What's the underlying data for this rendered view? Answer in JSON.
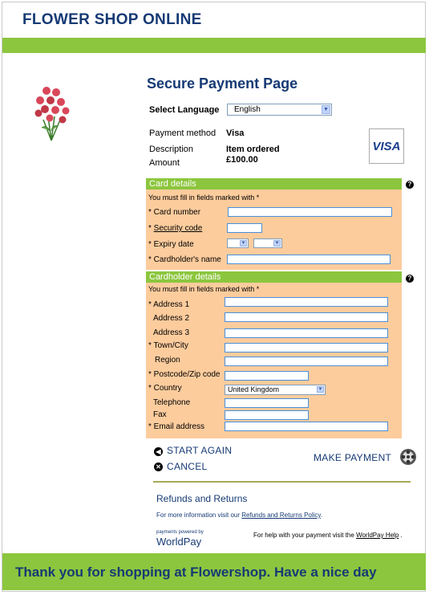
{
  "shop": {
    "title": "FLOWER SHOP ONLINE"
  },
  "page": {
    "title": "Secure Payment Page"
  },
  "language": {
    "label": "Select Language",
    "selected": "English"
  },
  "payment": {
    "method_label": "Payment method",
    "method_value": "Visa",
    "description_label": "Description",
    "description_value": "Item ordered",
    "amount_label": "Amount",
    "amount_value": "£100.00",
    "card_logo": "VISA"
  },
  "card_details": {
    "header": "Card details",
    "note": "You must fill in fields marked with *",
    "card_number_label": "* Card number",
    "security_code_prefix": "* ",
    "security_code_label": "Security code",
    "expiry_label": "* Expiry date",
    "cardholder_name_label": "* Cardholder's name"
  },
  "cardholder_details": {
    "header": "Cardholder details",
    "note": "You must fill in fields marked with *",
    "address1_label": "* Address 1",
    "address2_label": "Address 2",
    "address3_label": "Address 3",
    "town_label": "* Town/City",
    "region_label": "Region",
    "postcode_label": "* Postcode/Zip code",
    "country_label": "* Country",
    "country_value": "United Kingdom",
    "telephone_label": "Telephone",
    "fax_label": "Fax",
    "email_label": "* Email address"
  },
  "help_icon_glyph": "?",
  "actions": {
    "start_again": "START AGAIN",
    "cancel": "CANCEL",
    "make_payment": "MAKE PAYMENT"
  },
  "refunds": {
    "title": "Refunds and Returns",
    "text_prefix": "For more information visit our ",
    "link": "Refunds and Returns Policy",
    "text_suffix": "."
  },
  "worldpay": {
    "caption": "payments powered by",
    "logo": "WorldPay",
    "help_prefix": "For help with your payment visit the ",
    "help_link": "WorldPay Help",
    "help_suffix": " ."
  },
  "footer": {
    "text": "Thank you for shopping at Flowershop. Have a nice day"
  },
  "colors": {
    "brand_green": "#8cc63e",
    "panel_peach": "#fdcc9d",
    "navy": "#163a74"
  },
  "icons": [
    "flower-bouquet-icon",
    "help-icon",
    "dropdown-arrow-icon",
    "start-again-icon",
    "cancel-icon",
    "make-payment-icon"
  ]
}
